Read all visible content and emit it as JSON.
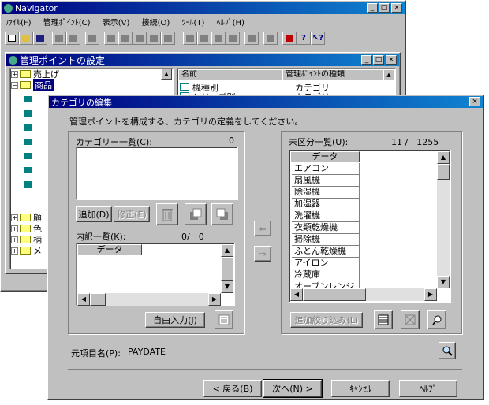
{
  "main_window": {
    "title": "Navigator",
    "menu": [
      "ﾌｧｲﾙ(F)",
      "管理ﾎﾟｲﾝﾄ(C)",
      "表示(V)",
      "接続(O)",
      "ﾂｰﾙ(T)",
      "ﾍﾙﾌﾟ(H)"
    ]
  },
  "mgmt_window": {
    "title": "管理ポイントの設定",
    "tree": [
      "売上げ",
      "商品",
      "顧",
      "色",
      "柄",
      "メ"
    ],
    "list_headers": [
      "名前",
      "管理ﾎﾟｲﾝﾄの種類"
    ],
    "list_rows": [
      {
        "name": "機種別",
        "type": "カテゴリ"
      },
      {
        "name": "シリーズ別",
        "type": "カテゴリ"
      }
    ]
  },
  "dialog": {
    "title": "カテゴリの編集",
    "instruction": "管理ポイントを構成する、カテゴリの定義をしてください。",
    "category_label": "カテゴリー一覧(C):",
    "category_count": "0",
    "add_button": "追加(D)",
    "modify_button": "修正(E)",
    "breakdown_label": "内訳一覧(K):",
    "breakdown_count": "0/　0",
    "breakdown_column": "データ",
    "free_input_button": "自由入力(J)",
    "unclassified_label": "未区分一覧(U):",
    "unclassified_count": "11 /　1255",
    "unclassified_column": "データ",
    "unclassified_items": [
      "エアコン",
      "扇風機",
      "除湿機",
      "加湿器",
      "洗濯機",
      "衣類乾燥機",
      "掃除機",
      "ふとん乾燥機",
      "アイロン",
      "冷蔵庫",
      "オーブンレンジ"
    ],
    "add_filter_button": "追加絞り込み(L)",
    "source_field_label": "元項目名(P):",
    "source_field_value": "PAYDATE",
    "back_button": "< 戻る(B)",
    "next_button": "次へ(N) >",
    "cancel_button": "ｷｬﾝｾﾙ",
    "help_button": "ﾍﾙﾌﾟ"
  }
}
